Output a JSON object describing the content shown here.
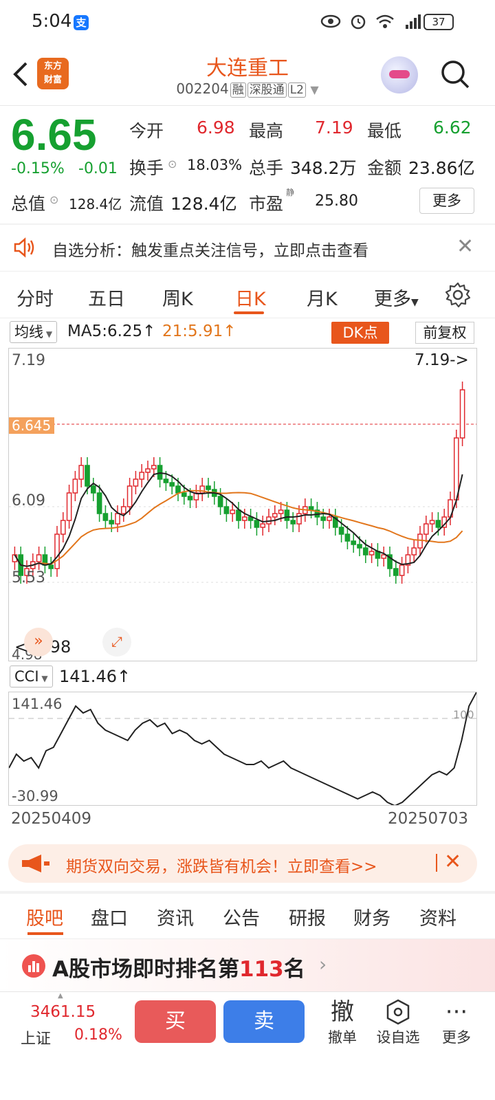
{
  "status_bar": {
    "time": "5:04",
    "alipay_badge": "支",
    "battery": "37",
    "network": "4G"
  },
  "header": {
    "back_icon": "chevron-left-icon",
    "app_logo_line1": "东方",
    "app_logo_line2": "财富",
    "stock_name": "大连重工",
    "stock_code": "002204",
    "tags": [
      "融",
      "深股通",
      "L2"
    ]
  },
  "quote": {
    "price": "6.65",
    "change_pct": "-0.15%",
    "change_val": "-0.01",
    "open_label": "今开",
    "open": "6.98",
    "high_label": "最高",
    "high": "7.19",
    "low_label": "最低",
    "low": "6.62",
    "turnover_label": "换手",
    "turnover": "18.03%",
    "volume_label": "总手",
    "volume": "348.2万",
    "amount_label": "金额",
    "amount": "23.86亿",
    "mktcap_label": "总值",
    "mktcap": "128.4亿",
    "float_label": "流值",
    "float_val": "128.4亿",
    "pe_label": "市盈",
    "pe_sup": "静",
    "pe": "25.80",
    "more_label": "更多"
  },
  "notice": {
    "text": "自选分析：触发重点关注信号，立即点击查看"
  },
  "chart_tabs": [
    "分时",
    "五日",
    "周K",
    "日K",
    "月K",
    "更多"
  ],
  "ma_bar": {
    "selector": "均线",
    "ma5": "MA5:6.25",
    "ma21": "21:5.91",
    "dk_label": "DK点",
    "fq_label": "前复权"
  },
  "kline": {
    "y_top": "7.19",
    "y_mid": "6.09",
    "y_low": "5.53",
    "y_bottom": "4.98",
    "high_marker": "7.19->",
    "low_marker": "<-4.98",
    "current_tag": "6.645"
  },
  "cci": {
    "selector": "CCI",
    "value": "141.46",
    "y_top": "141.46",
    "y_bottom": "-30.99",
    "line_label": "100"
  },
  "dates": {
    "start": "20250409",
    "end": "20250703"
  },
  "banner": {
    "text": "期货双向交易，涨跌皆有机会！立即查看>>"
  },
  "bottom_tabs": [
    "股吧",
    "盘口",
    "资讯",
    "公告",
    "研报",
    "财务",
    "资料"
  ],
  "rank": {
    "prefix": "A股市场即时排名第",
    "number": "113",
    "suffix": "名"
  },
  "bottom_bar": {
    "index_value": "3461.15",
    "index_name": "上证",
    "index_pct": "0.18%",
    "buy": "买",
    "sell": "卖",
    "cancel_glyph": "撤",
    "cancel": "撤单",
    "watch": "设自选",
    "more": "更多"
  },
  "colors": {
    "accent": "#e8561c",
    "up": "#e0282e",
    "down": "#16a030",
    "ma": "#e2761c"
  }
}
